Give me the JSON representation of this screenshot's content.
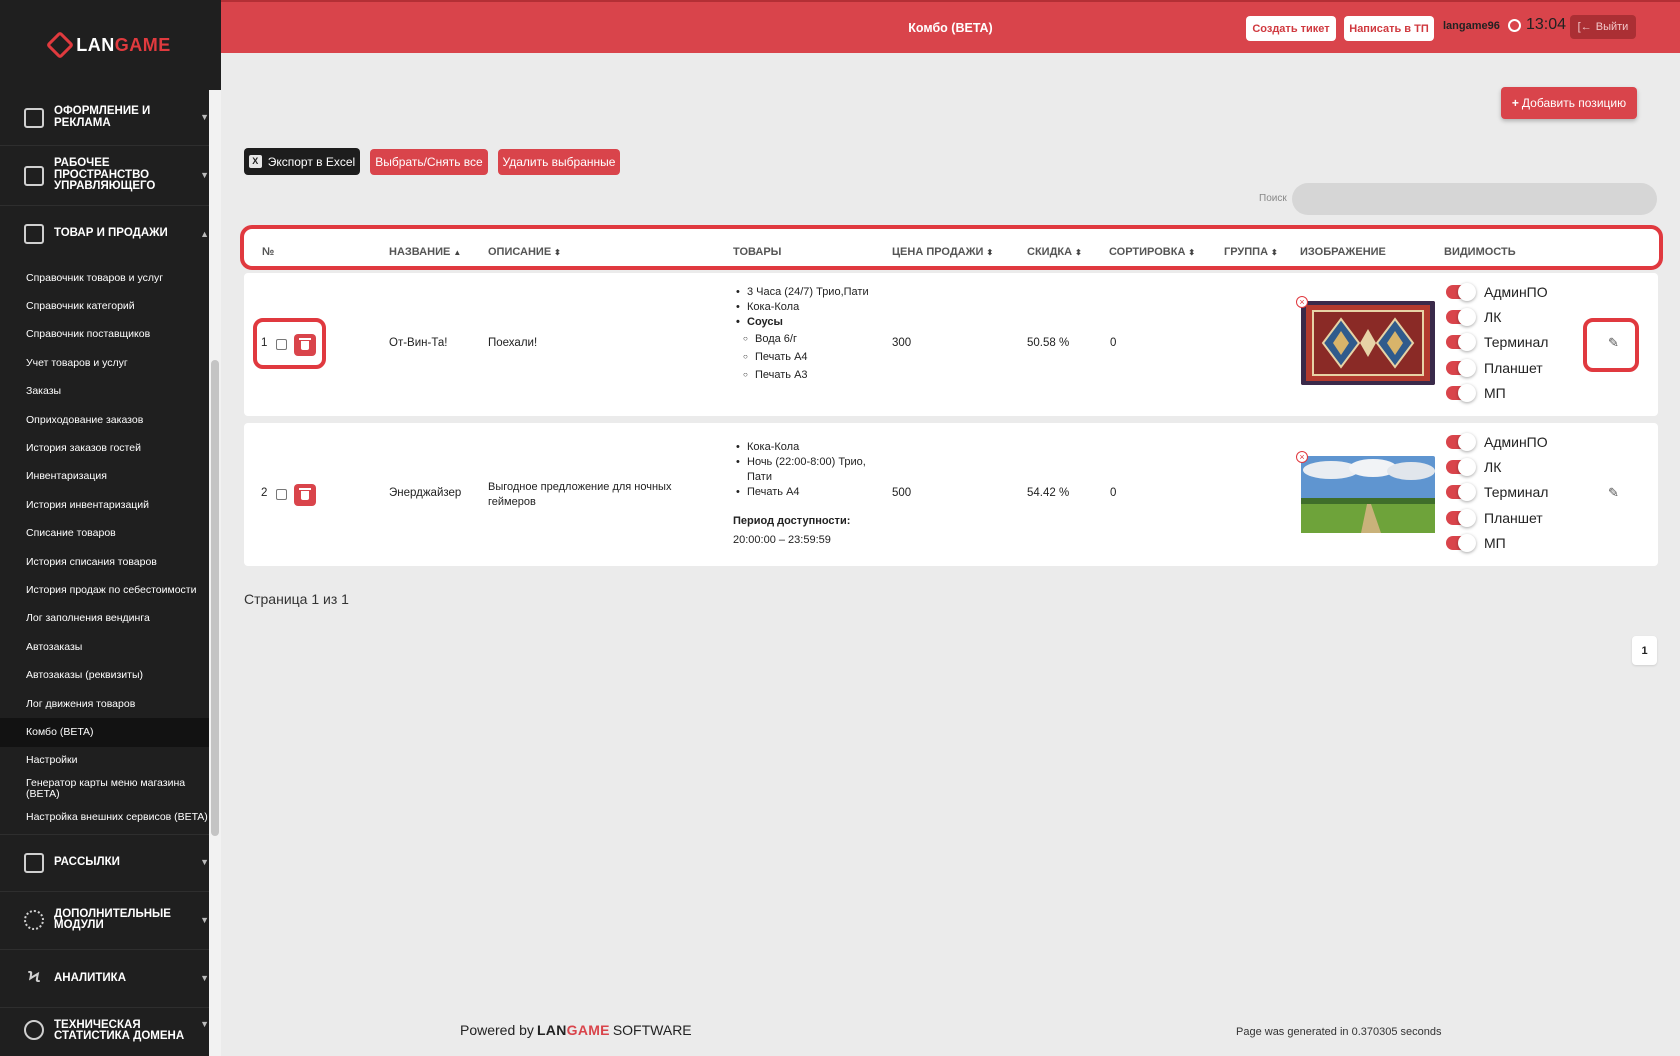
{
  "brand": {
    "logo_prefix": "LAN",
    "logo_suffix": "GAME"
  },
  "sidebar": {
    "sections_top": [
      {
        "label": "Оформление и реклама",
        "icon": "edit-icon"
      },
      {
        "label": "Рабочее пространство управляющего",
        "icon": "briefcase-icon"
      },
      {
        "label": "Товар и продажи",
        "icon": "tag-icon"
      }
    ],
    "items": [
      "Справочник товаров и услуг",
      "Справочник категорий",
      "Справочник поставщиков",
      "Учет товаров и услуг",
      "Заказы",
      "Оприходование заказов",
      "История заказов гостей",
      "Инвентаризация",
      "История инвентаризаций",
      "Списание товаров",
      "История списания товаров",
      "История продаж по себестоимости",
      "Лог заполнения вендинга",
      "Автозаказы",
      "Автозаказы (реквизиты)",
      "Лог движения товаров",
      "Комбо (BETA)",
      "Настройки",
      "Генератор карты меню магазина (BETA)",
      "Настройка внешних сервисов (BETA)"
    ],
    "active_item": "Комбо (BETA)",
    "sections_bottom": [
      {
        "label": "Рассылки",
        "icon": "edit-icon"
      },
      {
        "label": "Дополнительные модули",
        "icon": "gear-icon"
      },
      {
        "label": "Аналитика",
        "icon": "bolt-icon"
      },
      {
        "label": "Техническая статистика домена",
        "icon": "pie-icon"
      }
    ]
  },
  "header": {
    "title": "Комбо (BETA)",
    "create_ticket": "Создать тикет",
    "write_support": "Написать в ТП",
    "username": "langame96",
    "time": "13:04",
    "logout": "Выйти"
  },
  "toolbar": {
    "add_position": "Добавить позицию",
    "export_excel": "Экспорт в Excel",
    "select_all": "Выбрать/Снять все",
    "delete_selected": "Удалить выбранные",
    "search_label": "Поиск",
    "search_value": ""
  },
  "table": {
    "columns": {
      "num": "№",
      "name": "Название",
      "description": "Описание",
      "goods": "Товары",
      "price": "Цена продажи",
      "discount": "Скидка",
      "sorting": "Сортировка",
      "group": "Группа",
      "image": "Изображение",
      "visibility": "Видимость"
    },
    "rows": [
      {
        "num": "1",
        "name": "От-Вин-Та!",
        "description": "Поехали!",
        "goods": [
          {
            "text": "3 Часа (24/7) Трио,Пати",
            "level": 1
          },
          {
            "text": "Кока-Кола",
            "level": 1
          },
          {
            "text": "Соусы",
            "level": 1,
            "bold": true
          },
          {
            "text": "Вода 6/г",
            "level": 2
          },
          {
            "text": "Печать А4",
            "level": 2
          },
          {
            "text": "Печать А3",
            "level": 2
          }
        ],
        "price": "300",
        "discount": "50.58 %",
        "sorting": "0",
        "group": "",
        "image": "carpet",
        "visibility": [
          {
            "label": "АдминПО",
            "on": true
          },
          {
            "label": "ЛК",
            "on": true
          },
          {
            "label": "Терминал",
            "on": true
          },
          {
            "label": "Планшет",
            "on": true
          },
          {
            "label": "МП",
            "on": true
          }
        ]
      },
      {
        "num": "2",
        "name": "Энерджайзер",
        "description": "Выгодное предложение для ночных геймеров",
        "goods": [
          {
            "text": "Кока-Кола",
            "level": 1
          },
          {
            "text": "Ночь (22:00-8:00) Трио, Пати",
            "level": 1
          },
          {
            "text": "Печать А4",
            "level": 1
          }
        ],
        "period_label": "Период доступности:",
        "period_value": "20:00:00 – 23:59:59",
        "price": "500",
        "discount": "54.42 %",
        "sorting": "0",
        "group": "",
        "image": "landscape",
        "visibility": [
          {
            "label": "АдминПО",
            "on": true
          },
          {
            "label": "ЛК",
            "on": true
          },
          {
            "label": "Терминал",
            "on": true
          },
          {
            "label": "Планшет",
            "on": true
          },
          {
            "label": "МП",
            "on": true
          }
        ]
      }
    ]
  },
  "pagination": {
    "info": "Страница 1 из 1",
    "current": "1"
  },
  "footer": {
    "powered_by": "Powered by",
    "brand_prefix": "LAN",
    "brand_suffix": "GAME",
    "software": "SOFTWARE",
    "generated": "Page was generated in 0.370305 seconds"
  },
  "colors": {
    "accent": "#d9444b",
    "sidebar": "#1f1f1f",
    "highlight": "#e0393f"
  }
}
